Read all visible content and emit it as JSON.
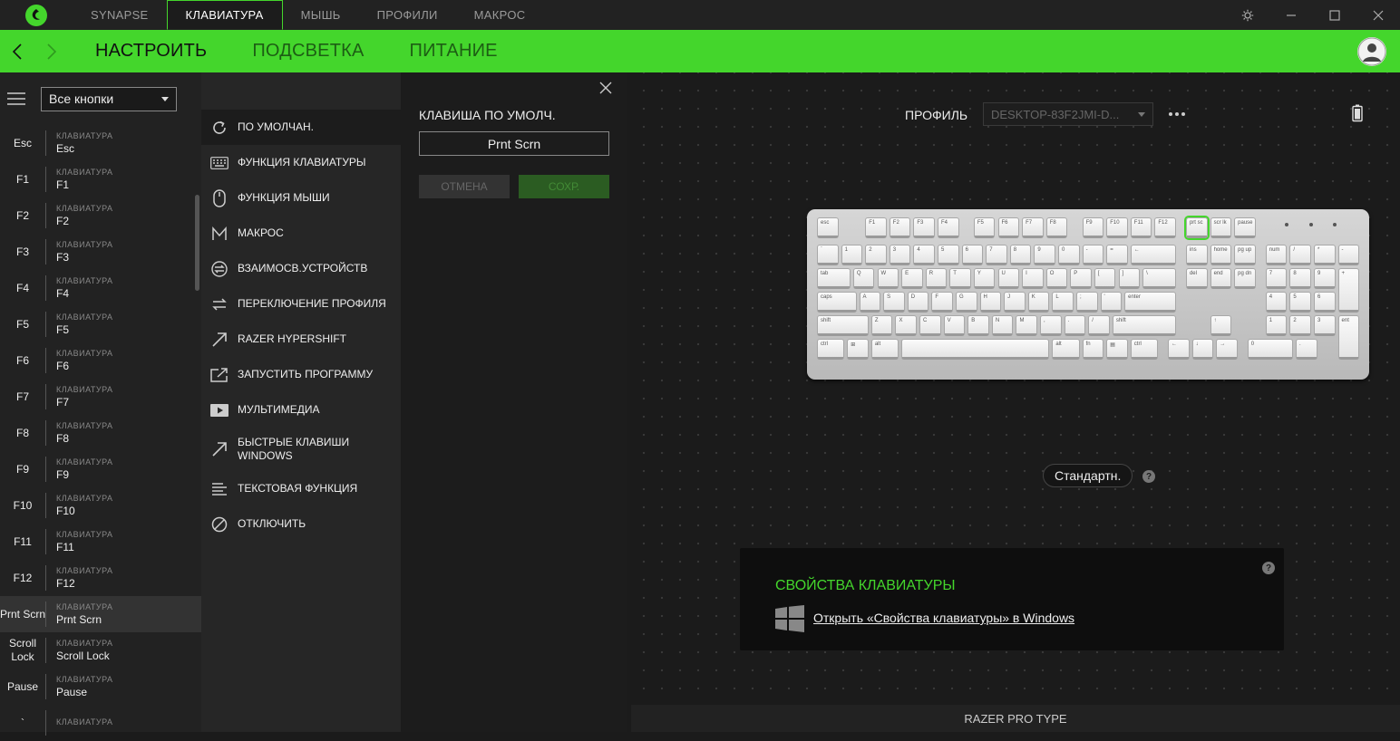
{
  "colors": {
    "accent": "#44d62c",
    "bg": "#1b1b1b"
  },
  "topnav": {
    "tabs": [
      {
        "label": "SYNAPSE",
        "active": false
      },
      {
        "label": "КЛАВИАТУРА",
        "active": true
      },
      {
        "label": "МЫШЬ",
        "active": false
      },
      {
        "label": "ПРОФИЛИ",
        "active": false
      },
      {
        "label": "МАКРОС",
        "active": false
      }
    ],
    "icons": [
      "razer-logo-icon",
      "settings-icon",
      "minimize-icon",
      "maximize-icon",
      "close-icon"
    ]
  },
  "subnav": {
    "tabs": [
      {
        "label": "НАСТРОИТЬ",
        "active": true
      },
      {
        "label": "ПОДСВЕТКА",
        "active": false
      },
      {
        "label": "ПИТАНИЕ",
        "active": false
      }
    ]
  },
  "keylist": {
    "filter": "Все кнопки",
    "items": [
      {
        "key": "Esc",
        "category": "КЛАВИАТУРА",
        "value": "Esc",
        "selected": false
      },
      {
        "key": "F1",
        "category": "КЛАВИАТУРА",
        "value": "F1",
        "selected": false
      },
      {
        "key": "F2",
        "category": "КЛАВИАТУРА",
        "value": "F2",
        "selected": false
      },
      {
        "key": "F3",
        "category": "КЛАВИАТУРА",
        "value": "F3",
        "selected": false
      },
      {
        "key": "F4",
        "category": "КЛАВИАТУРА",
        "value": "F4",
        "selected": false
      },
      {
        "key": "F5",
        "category": "КЛАВИАТУРА",
        "value": "F5",
        "selected": false
      },
      {
        "key": "F6",
        "category": "КЛАВИАТУРА",
        "value": "F6",
        "selected": false
      },
      {
        "key": "F7",
        "category": "КЛАВИАТУРА",
        "value": "F7",
        "selected": false
      },
      {
        "key": "F8",
        "category": "КЛАВИАТУРА",
        "value": "F8",
        "selected": false
      },
      {
        "key": "F9",
        "category": "КЛАВИАТУРА",
        "value": "F9",
        "selected": false
      },
      {
        "key": "F10",
        "category": "КЛАВИАТУРА",
        "value": "F10",
        "selected": false
      },
      {
        "key": "F11",
        "category": "КЛАВИАТУРА",
        "value": "F11",
        "selected": false
      },
      {
        "key": "F12",
        "category": "КЛАВИАТУРА",
        "value": "F12",
        "selected": false
      },
      {
        "key": "Prnt Scrn",
        "category": "КЛАВИАТУРА",
        "value": "Prnt Scrn",
        "selected": true
      },
      {
        "key": "Scroll Lock",
        "category": "КЛАВИАТУРА",
        "value": "Scroll Lock",
        "selected": false
      },
      {
        "key": "Pause",
        "category": "КЛАВИАТУРА",
        "value": "Pause",
        "selected": false
      },
      {
        "key": "`",
        "category": "КЛАВИАТУРА",
        "value": "",
        "selected": false
      }
    ]
  },
  "functions": [
    {
      "label": "ПО УМОЛЧАН.",
      "icon": "reset-icon",
      "selected": true
    },
    {
      "label": "ФУНКЦИЯ КЛАВИАТУРЫ",
      "icon": "keyboard-icon",
      "selected": false
    },
    {
      "label": "ФУНКЦИЯ МЫШИ",
      "icon": "mouse-icon",
      "selected": false
    },
    {
      "label": "МАКРОС",
      "icon": "macro-icon",
      "selected": false
    },
    {
      "label": "ВЗАИМОСВ.УСТРОЙСТВ",
      "icon": "interdevice-icon",
      "selected": false
    },
    {
      "label": "ПЕРЕКЛЮЧЕНИЕ ПРОФИЛЯ",
      "icon": "switch-profile-icon",
      "selected": false
    },
    {
      "label": "RAZER HYPERSHIFT",
      "icon": "hypershift-icon",
      "selected": false
    },
    {
      "label": "ЗАПУСТИТЬ ПРОГРАММУ",
      "icon": "launch-program-icon",
      "selected": false
    },
    {
      "label": "МУЛЬТИМЕДИА",
      "icon": "multimedia-icon",
      "selected": false
    },
    {
      "label": "БЫСТРЫЕ КЛАВИШИ WINDOWS",
      "icon": "windows-shortcut-icon",
      "selected": false
    },
    {
      "label": "ТЕКСТОВАЯ ФУНКЦИЯ",
      "icon": "text-function-icon",
      "selected": false
    },
    {
      "label": "ОТКЛЮЧИТЬ",
      "icon": "disable-icon",
      "selected": false
    }
  ],
  "detail": {
    "title": "КЛАВИША ПО УМОЛЧ.",
    "key_value": "Prnt Scrn",
    "cancel": "ОТМЕНА",
    "save": "СОХР."
  },
  "main": {
    "profile_label": "ПРОФИЛЬ",
    "profile_value": "DESKTOP-83F2JMI-D...",
    "mode": "Стандартн.",
    "props_title": "СВОЙСТВА КЛАВИАТУРЫ",
    "props_link": "Открыть «Свойства клавиатуры» в Windows",
    "device": "RAZER PRO TYPE",
    "keyboard_image": "razer-pro-type-keyboard-image",
    "selected_key": "Prnt Scrn"
  }
}
